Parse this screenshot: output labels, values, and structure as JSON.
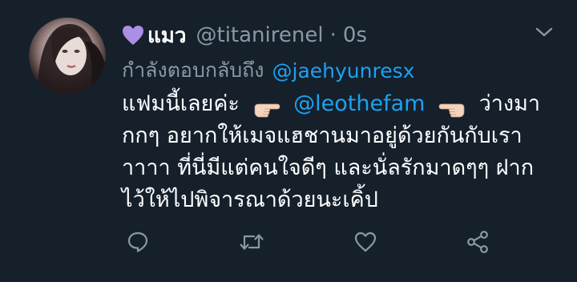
{
  "tweet": {
    "display_name": "แมว",
    "handle": "@titanirenel",
    "separator": "·",
    "time": "0s",
    "reply_prefix": "กำลังตอบกลับถึง",
    "reply_mention": "@jaehyunresx",
    "body": {
      "line1_prefix": "แฟมนี้เลยค่ะ",
      "line1_mention": "@leothefam",
      "line1_suffix": "ว่างมา",
      "line2": "กกๆ อยากให้เมจแฮชานมาอยู่ด้วยกันกับเรา",
      "line3": "าาาา ที่นี่มีแต่คนใจดีๆ และนั่ลรักมาดๆๆ ฝาก",
      "line4": "ไว้ให้ไปพิจารณาด้วยนะเคิ้ป"
    },
    "icons": {
      "name_prefix": "purple-heart-icon",
      "menu": "chevron-down-icon",
      "emoji_left": "backhand-index-pointing-right-icon",
      "emoji_right": "backhand-index-pointing-left-icon"
    },
    "actions": [
      "reply-icon",
      "retweet-icon",
      "like-icon",
      "share-icon"
    ],
    "colors": {
      "background": "#15202b",
      "secondary_text": "#8899a6",
      "link": "#1da1f2",
      "heart": "#ac8ee6"
    }
  }
}
